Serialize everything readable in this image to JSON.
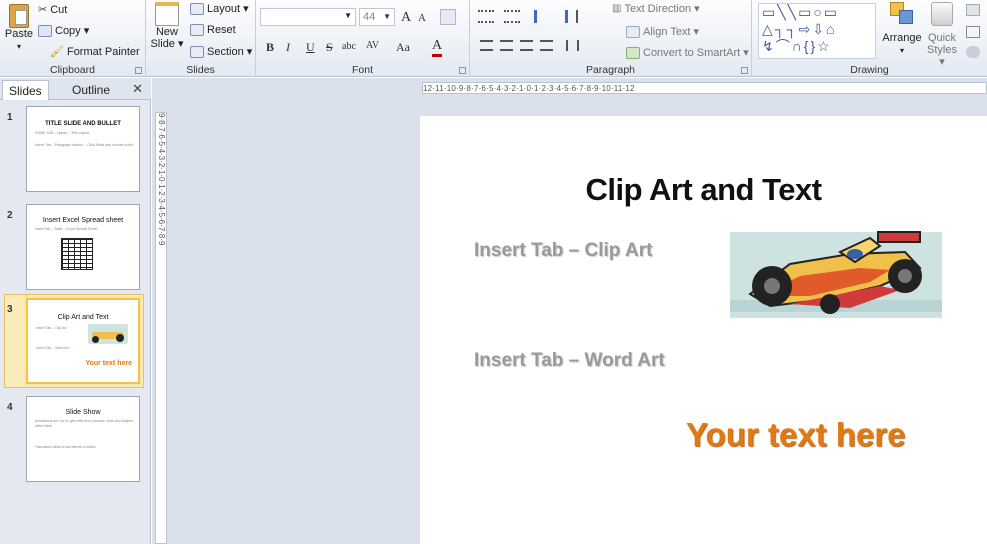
{
  "ribbon": {
    "clipboard": {
      "group_label": "Clipboard",
      "paste": "Paste",
      "cut": "Cut",
      "copy": "Copy ▾",
      "format_painter": "Format Painter"
    },
    "slides": {
      "group_label": "Slides",
      "new_slide_1": "New",
      "new_slide_2": "Slide ▾",
      "layout": "Layout ▾",
      "reset": "Reset",
      "section": "Section ▾"
    },
    "font": {
      "group_label": "Font",
      "font_size": "44",
      "grow": "A",
      "shrink": "A",
      "bold": "B",
      "italic": "I",
      "underline": "U",
      "strike": "S",
      "shadow": "abc",
      "spacing": "AV",
      "case": "Aa",
      "color": "A"
    },
    "paragraph": {
      "group_label": "Paragraph",
      "text_direction": "Text Direction ▾",
      "align_text": "Align Text ▾",
      "smartart": "Convert to SmartArt ▾"
    },
    "drawing": {
      "group_label": "Drawing",
      "arrange": "Arrange",
      "quick_styles_1": "Quick",
      "quick_styles_2": "Styles ▾"
    }
  },
  "panel": {
    "tab_slides": "Slides",
    "tab_outline": "Outline",
    "close": "✕",
    "thumbs": [
      {
        "num": "1",
        "title": "TITLE SLIDE AND BULLET",
        "l1": "HOME TAB – Layout – Title Layout",
        "l2": "Home Tab – Paragraph section – Click Bullet and choose bullet"
      },
      {
        "num": "2",
        "title": "Insert Excel Spread sheet",
        "l1": "Insert Tab – Table – Excel Spread Sheet"
      },
      {
        "num": "3",
        "title": "Clip Art and Text",
        "l1": "Insert Tab – Clip Art",
        "l2": "Insert Tab – Word Art",
        "wordart": "Your text here"
      },
      {
        "num": "4",
        "title": "Slide Show",
        "l1": "Animations are use to give effects to pictures, texts and shapes within slide",
        "l2": "Transitions allow to set effects of slides"
      }
    ]
  },
  "ruler": {
    "horizontal": "12·11·10·9·8·7·6·5·4·3·2·1·0·1·2·3·4·5·6·7·8·9·10·11·12",
    "vertical": "9·8·7·6·5·4·3·2·1·0·1·2·3·4·5·6·7·8·9"
  },
  "slide": {
    "title": "Clip Art and Text",
    "bullet1": "Insert Tab – Clip Art",
    "bullet2": "Insert Tab – Word Art",
    "wordart": "Your text here"
  },
  "colors": {
    "accent_orange": "#e07a15",
    "selection": "#fcecb9",
    "ribbon_bg": "#e3e9f2"
  }
}
